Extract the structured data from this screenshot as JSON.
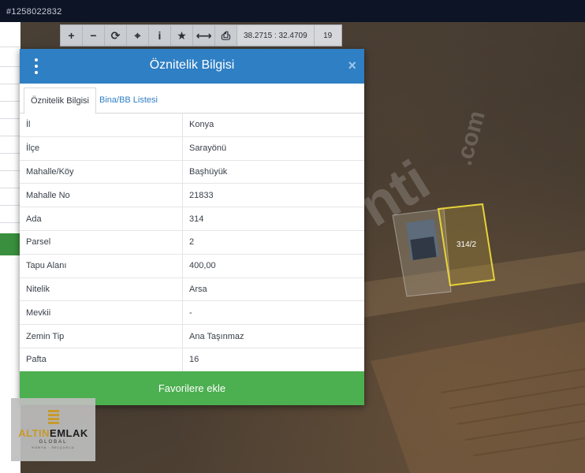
{
  "listing_id": "#1258022832",
  "toolbar": {
    "buttons": [
      {
        "name": "zoom-in-icon",
        "glyph": "+"
      },
      {
        "name": "zoom-out-icon",
        "glyph": "−"
      },
      {
        "name": "refresh-icon",
        "glyph": "⟳"
      },
      {
        "name": "locate-icon",
        "glyph": "⌖"
      },
      {
        "name": "info-icon",
        "glyph": "i"
      },
      {
        "name": "star-icon",
        "glyph": "★"
      },
      {
        "name": "measure-icon",
        "glyph": "⟷"
      },
      {
        "name": "print-icon",
        "glyph": "⎙"
      }
    ],
    "coords": "38.2715 : 32.4709",
    "zoom": "19"
  },
  "parcel_label": "314/2",
  "modal": {
    "title": "Öznitelik Bilgisi",
    "close_glyph": "×",
    "tabs": [
      {
        "label": "Öznitelik Bilgisi",
        "active": true
      },
      {
        "label": "Bina/BB Listesi",
        "active": false
      }
    ],
    "rows": [
      {
        "key": "İl",
        "value": "Konya"
      },
      {
        "key": "İlçe",
        "value": "Sarayönü"
      },
      {
        "key": "Mahalle/Köy",
        "value": "Başhüyük"
      },
      {
        "key": "Mahalle No",
        "value": "21833"
      },
      {
        "key": "Ada",
        "value": "314"
      },
      {
        "key": "Parsel",
        "value": "2"
      },
      {
        "key": "Tapu Alanı",
        "value": "400,00"
      },
      {
        "key": "Nitelik",
        "value": "Arsa"
      },
      {
        "key": "Mevkii",
        "value": "-"
      },
      {
        "key": "Zemin Tip",
        "value": "Ana Taşınmaz"
      },
      {
        "key": "Pafta",
        "value": "16"
      }
    ],
    "favorite_button": "Favorilere ekle"
  },
  "logo": {
    "brand_a": "ALTIN",
    "brand_b": "EMLAK",
    "sub": "GLOBAL",
    "sub2": "KONYA · SELÇUKLU"
  },
  "colors": {
    "header_blue": "#2f7fc4",
    "button_green": "#4caf50",
    "parcel_outline": "#e6d23a"
  }
}
